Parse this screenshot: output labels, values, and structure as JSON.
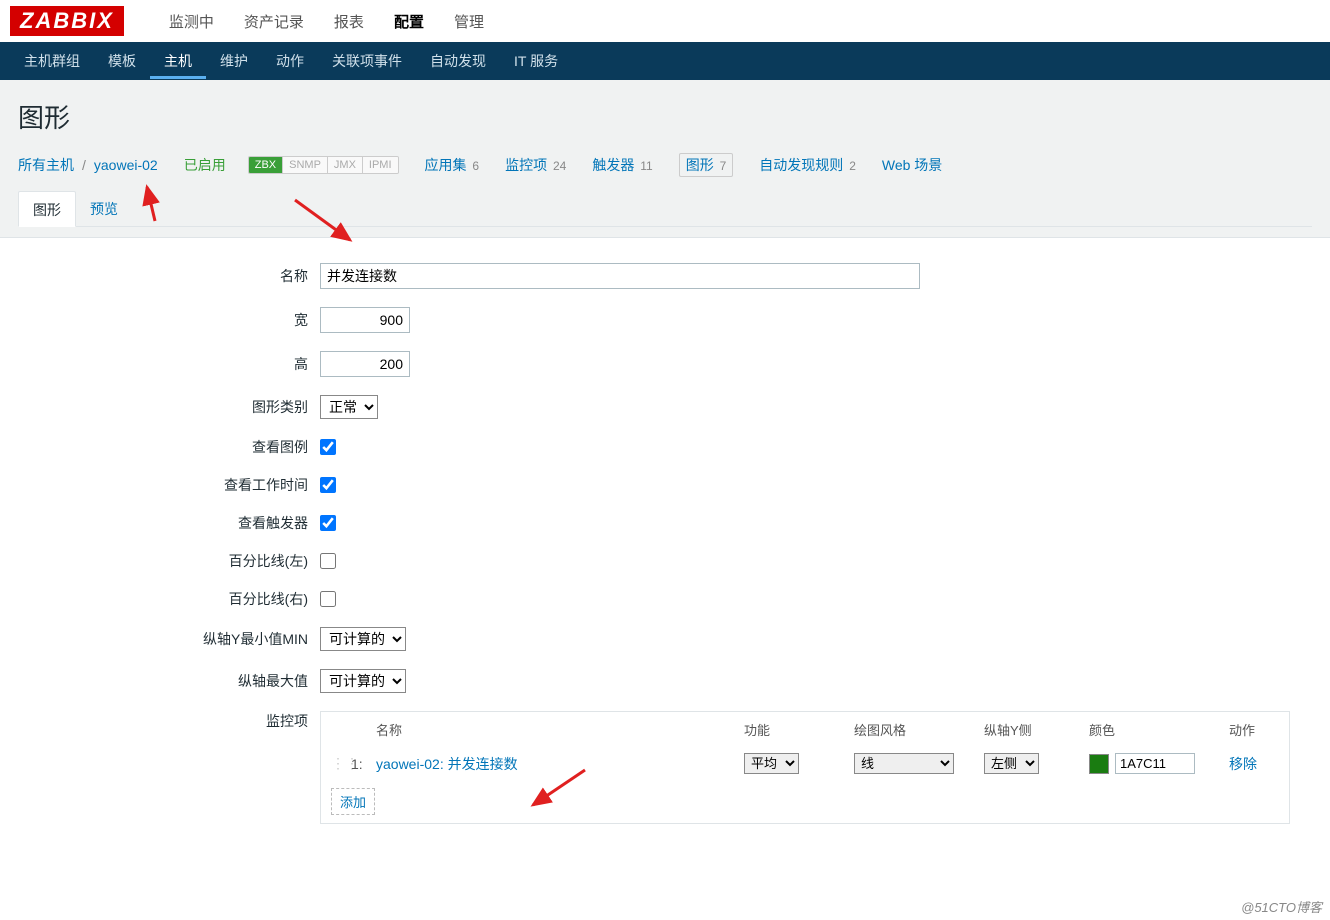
{
  "logo": "ZABBIX",
  "topNav": [
    "监测中",
    "资产记录",
    "报表",
    "配置",
    "管理"
  ],
  "topNavActive": 3,
  "subNav": [
    "主机群组",
    "模板",
    "主机",
    "维护",
    "动作",
    "关联项事件",
    "自动发现",
    "IT 服务"
  ],
  "subNavActive": 2,
  "pageTitle": "图形",
  "breadcrumb": {
    "allHosts": "所有主机",
    "host": "yaowei-02",
    "status": "已启用",
    "tags": [
      "ZBX",
      "SNMP",
      "JMX",
      "IPMI"
    ],
    "links": [
      {
        "label": "应用集",
        "count": "6"
      },
      {
        "label": "监控项",
        "count": "24"
      },
      {
        "label": "触发器",
        "count": "11"
      },
      {
        "label": "图形",
        "count": "7",
        "boxed": true
      },
      {
        "label": "自动发现规则",
        "count": "2"
      },
      {
        "label": "Web 场景",
        "count": ""
      }
    ]
  },
  "tabs": {
    "graph": "图形",
    "preview": "预览"
  },
  "form": {
    "labels": {
      "name": "名称",
      "width": "宽",
      "height": "高",
      "type": "图形类别",
      "legend": "查看图例",
      "workTime": "查看工作时间",
      "triggers": "查看触发器",
      "percentLeft": "百分比线(左)",
      "percentRight": "百分比线(右)",
      "yMin": "纵轴Y最小值MIN",
      "yMax": "纵轴最大值",
      "items": "监控项"
    },
    "values": {
      "name": "并发连接数",
      "width": "900",
      "height": "200",
      "type": "正常",
      "legend": true,
      "workTime": true,
      "triggers": true,
      "percentLeft": false,
      "percentRight": false,
      "yMin": "可计算的",
      "yMax": "可计算的"
    }
  },
  "itemsTable": {
    "headers": {
      "name": "名称",
      "func": "功能",
      "style": "绘图风格",
      "axis": "纵轴Y侧",
      "color": "颜色",
      "action": "动作"
    },
    "rows": [
      {
        "idx": "1:",
        "name": "yaowei-02: 并发连接数",
        "func": "平均",
        "style": "线",
        "axis": "左侧",
        "color": "1A7C11",
        "remove": "移除"
      }
    ],
    "addLabel": "添加"
  },
  "watermark": "@51CTO博客"
}
